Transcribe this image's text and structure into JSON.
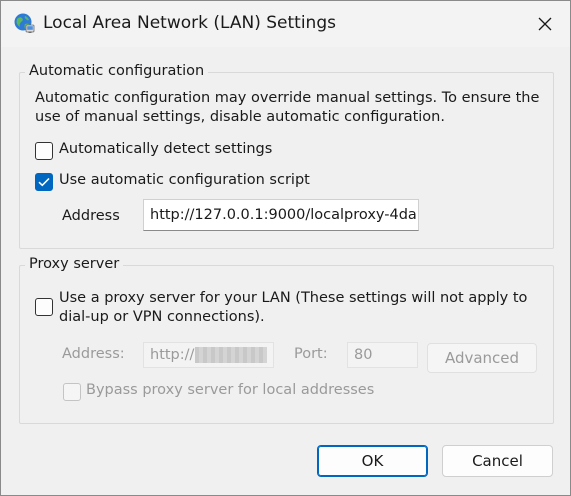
{
  "window": {
    "title": "Local Area Network (LAN) Settings",
    "accent_color": "#0067c0"
  },
  "auto_config": {
    "legend": "Automatic configuration",
    "description": "Automatic configuration may override manual settings.  To ensure the use of manual settings, disable automatic configuration.",
    "detect_label": "Automatically detect settings",
    "detect_checked": false,
    "script_label": "Use automatic configuration script",
    "script_checked": true,
    "address_label": "Address",
    "address_value": "http://127.0.0.1:9000/localproxy-4da"
  },
  "proxy": {
    "legend": "Proxy server",
    "use_proxy_label": "Use a proxy server for your LAN (These settings will not apply to dial-up or VPN connections).",
    "use_proxy_line1": "Use a proxy server for your LAN (These settings will not apply to",
    "use_proxy_line2": "dial-up or VPN connections).",
    "use_proxy_checked": false,
    "address_label": "Address:",
    "address_value": "http://",
    "port_label": "Port:",
    "port_value": "80",
    "advanced_label": "Advanced",
    "bypass_label": "Bypass proxy server for local addresses",
    "bypass_checked": false
  },
  "buttons": {
    "ok": "OK",
    "cancel": "Cancel"
  }
}
